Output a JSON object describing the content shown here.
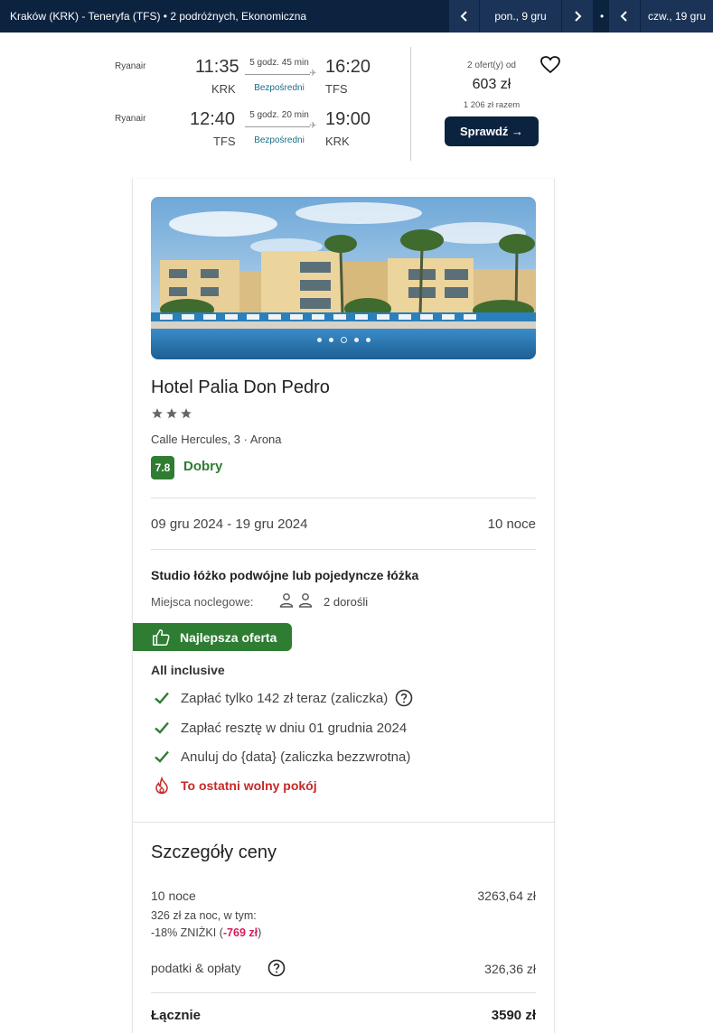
{
  "topbar": {
    "route": "Kraków (KRK) - Teneryfa (TFS)  •  2 podróżnych, Ekonomiczna",
    "date_out": "pon., 9 gru",
    "separator": "•",
    "date_back": "czw., 19 gru"
  },
  "flights": [
    {
      "airline": "Ryanair",
      "dep_time": "11:35",
      "dep_code": "KRK",
      "duration": "5 godz. 45 min",
      "stops": "Bezpośredni",
      "arr_time": "16:20",
      "arr_code": "TFS"
    },
    {
      "airline": "Ryanair",
      "dep_time": "12:40",
      "dep_code": "TFS",
      "duration": "5 godz. 20 min",
      "stops": "Bezpośredni",
      "arr_time": "19:00",
      "arr_code": "KRK"
    }
  ],
  "offer": {
    "offers_from": "2 ofert(y) od",
    "price": "603 zł",
    "total": "1 206 zł razem",
    "button": "Sprawdź →"
  },
  "hotel": {
    "name": "Hotel Palia Don Pedro",
    "stars": 3,
    "address": "Calle Hercules, 3 · Arona",
    "rating": "7.8",
    "rating_word": "Dobry",
    "dates": "09 gru 2024 - 19 gru 2024",
    "nights": "10 noce",
    "room_type": "Studio łóżko podwójne lub pojedyncze łóżka",
    "beds_label": "Miejsca noclegowe:",
    "beds_value": "2 dorośli",
    "best_offer": "Najlepsza oferta",
    "board": "All inclusive",
    "features": [
      "Zapłać tylko 142 zł teraz (zaliczka)",
      "Zapłać resztę w dniu 01 grudnia 2024",
      "Anuluj do {data} (zaliczka bezzwrotna)"
    ],
    "alert": "To ostatni wolny pokój",
    "photo_index": 3,
    "photo_count": 5
  },
  "price_details": {
    "title": "Szczegóły ceny",
    "nights_label": "10 noce",
    "nights_value": "3263,64 zł",
    "per_night": "326 zł za noc, w tym:",
    "discount_prefix": "-18% ZNIŻKI (",
    "discount_value": "-769 zł",
    "discount_suffix": ")",
    "taxes_label": "podatki & opłaty",
    "taxes_value": "326,36 zł",
    "total_label": "Łącznie",
    "total_value": "3590 zł"
  },
  "colors": {
    "navy": "#0c2340",
    "green": "#2e7d32",
    "alert_red": "#c62828",
    "discount_pink": "#d81b60"
  }
}
